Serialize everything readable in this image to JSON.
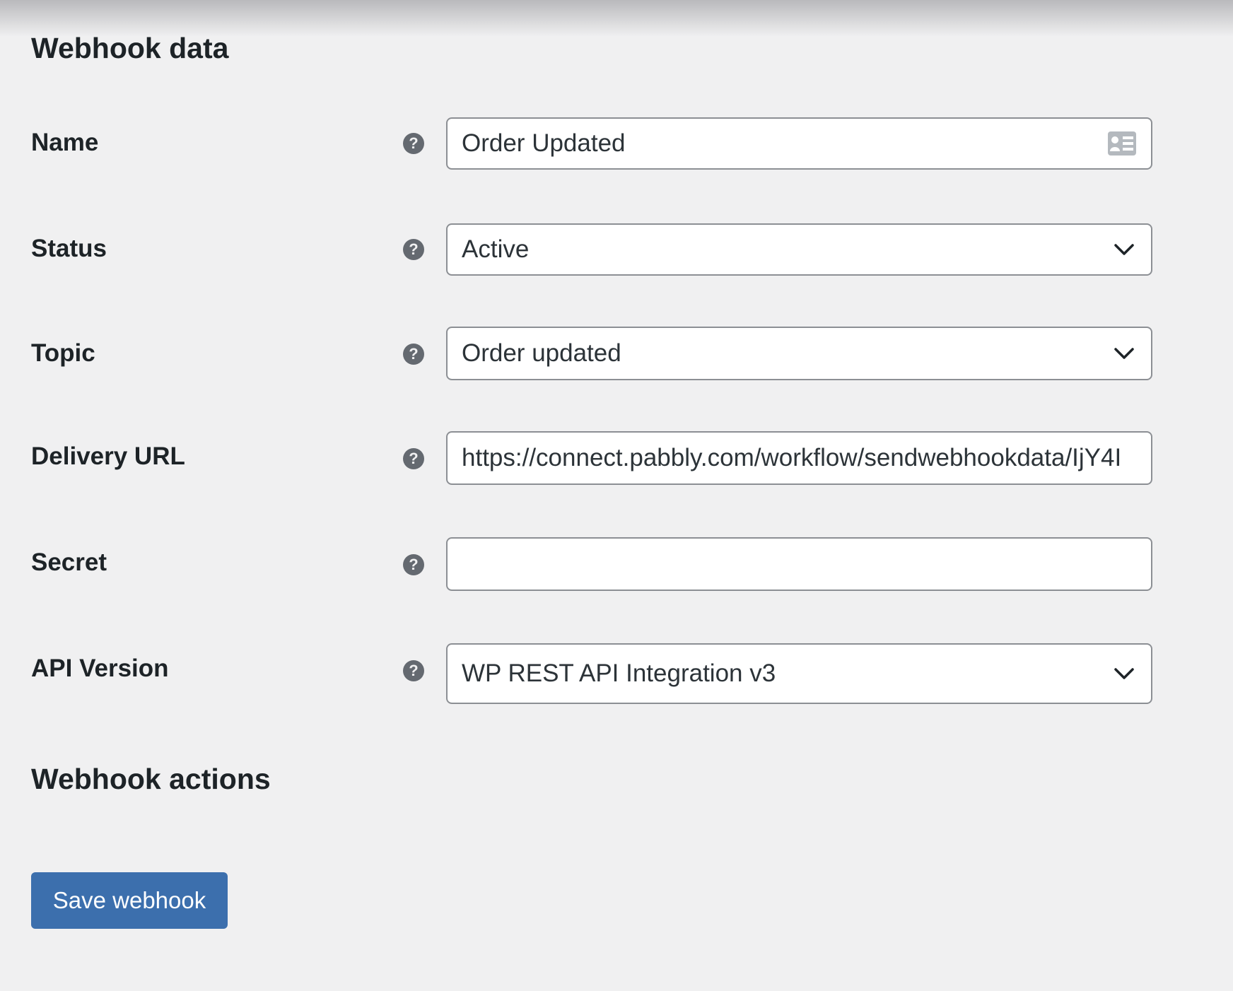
{
  "sections": {
    "data_title": "Webhook data",
    "actions_title": "Webhook actions"
  },
  "form": {
    "name": {
      "label": "Name",
      "value": "Order Updated",
      "icon": "contact-card-icon"
    },
    "status": {
      "label": "Status",
      "value": "Active"
    },
    "topic": {
      "label": "Topic",
      "value": "Order updated"
    },
    "delivery_url": {
      "label": "Delivery URL",
      "value": "https://connect.pabbly.com/workflow/sendwebhookdata/IjY4I"
    },
    "secret": {
      "label": "Secret",
      "value": ""
    },
    "api_version": {
      "label": "API Version",
      "value": "WP REST API Integration v3"
    }
  },
  "help_icon_glyph": "?",
  "actions": {
    "save_label": "Save webhook"
  },
  "colors": {
    "background": "#f0f0f1",
    "primary_button": "#3c6fad",
    "help_icon": "#646970",
    "field_border": "#8c8f94"
  }
}
